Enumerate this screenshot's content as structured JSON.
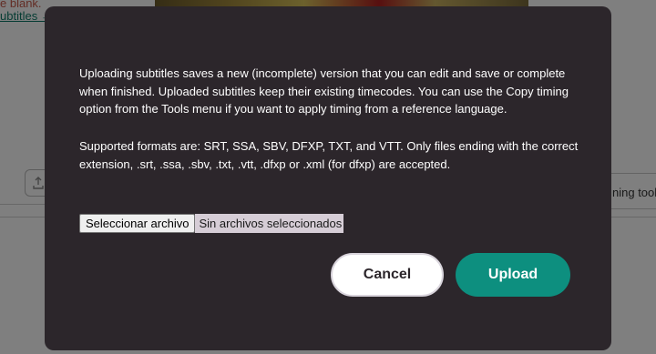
{
  "background": {
    "blank_text": "e blank.",
    "subtitles_link": "ubtitles →",
    "right_text": "ning tool",
    "upload_icon": "upload-icon"
  },
  "dialog": {
    "paragraph_1": "Uploading subtitles saves a new (incomplete) version that you can edit and save or complete when finished. Uploaded subtitles keep their existing timecodes. You can use the Copy timing option from the Tools menu if you want to apply timing from a reference language.",
    "paragraph_2": "Supported formats are: SRT, SSA, SBV, DFXP, TXT, and VTT. Only files ending with the correct extension, .srt, .ssa, .sbv, .txt, .vtt, .dfxp or .xml (for dfxp) are accepted.",
    "file_input": {
      "button_label": "Seleccionar archivo",
      "status_text": "Sin archivos seleccionados"
    },
    "cancel_label": "Cancel",
    "upload_label": "Upload"
  },
  "colors": {
    "modal_bg": "#2c262b",
    "upload_button": "#0d8f7f",
    "cancel_button": "#ffffff",
    "link_green": "#0f7b68"
  }
}
